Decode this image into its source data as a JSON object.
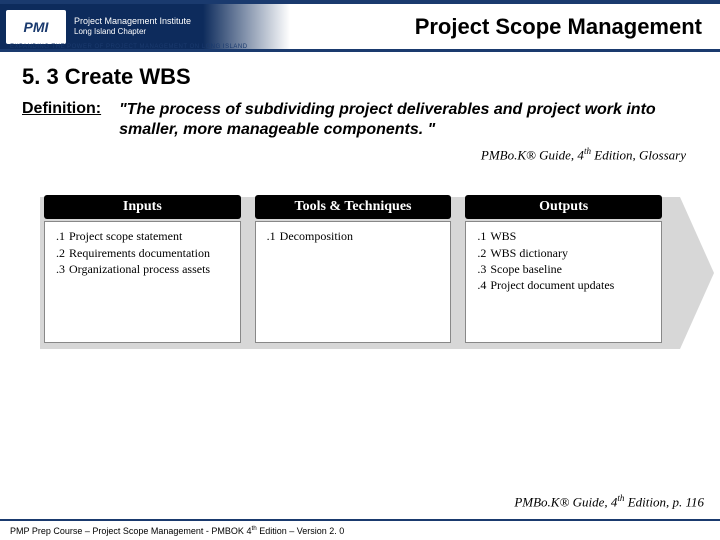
{
  "header": {
    "logo_abbr": "PMI",
    "logo_line1": "Project Management Institute",
    "logo_line2": "Long Island Chapter",
    "tagline": "EXPANDING THE POWER OF PROJECT MANAGEMENT ON LONG ISLAND",
    "slide_title": "Project Scope Management"
  },
  "section": {
    "title": "5. 3 Create WBS",
    "def_label": "Definition:",
    "def_text": "\"The process of subdividing project deliverables and project work into smaller, more manageable components. \"",
    "citation1": "PMBo.K® Guide, 4th Edition, Glossary"
  },
  "ito": {
    "headers": [
      "Inputs",
      "Tools & Techniques",
      "Outputs"
    ],
    "columns": [
      [
        {
          "n": ".1",
          "t": "Project scope statement"
        },
        {
          "n": ".2",
          "t": "Requirements documentation"
        },
        {
          "n": ".3",
          "t": "Organizational process assets"
        }
      ],
      [
        {
          "n": ".1",
          "t": "Decomposition"
        }
      ],
      [
        {
          "n": ".1",
          "t": "WBS"
        },
        {
          "n": ".2",
          "t": "WBS dictionary"
        },
        {
          "n": ".3",
          "t": "Scope baseline"
        },
        {
          "n": ".4",
          "t": "Project document updates"
        }
      ]
    ]
  },
  "citation2": "PMBo.K® Guide, 4th Edition, p. 116",
  "footer": "PMP Prep Course – Project Scope Management - PMBOK 4th Edition – Version 2. 0"
}
